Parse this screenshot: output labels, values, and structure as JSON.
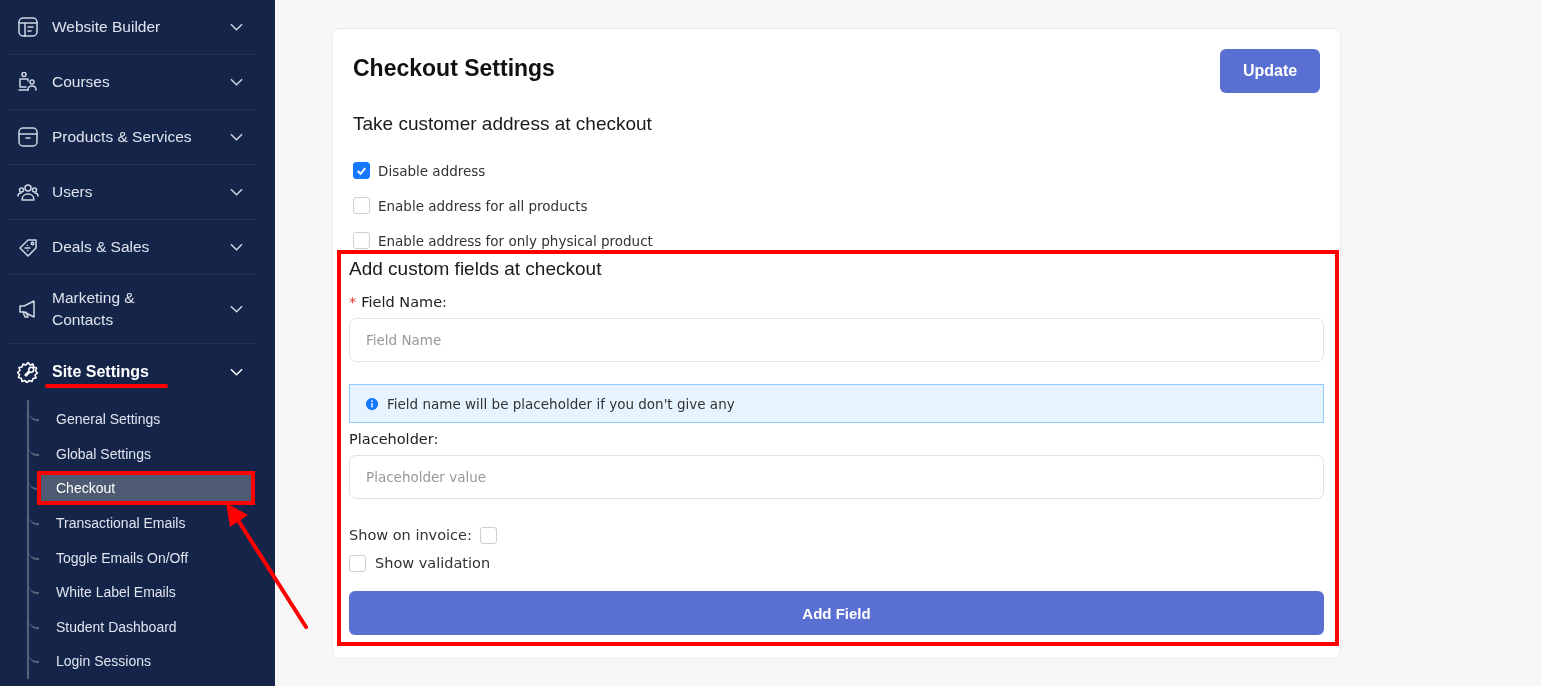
{
  "sidebar": {
    "items": [
      {
        "kind": "layout",
        "label": "Website Builder",
        "expanded": false,
        "selected": false
      },
      {
        "kind": "courses",
        "label": "Courses",
        "expanded": false,
        "selected": false
      },
      {
        "kind": "box",
        "label": "Products & Services",
        "expanded": false,
        "selected": false
      },
      {
        "kind": "users",
        "label": "Users",
        "expanded": false,
        "selected": false
      },
      {
        "kind": "tag",
        "label": "Deals & Sales",
        "expanded": false,
        "selected": false
      },
      {
        "kind": "megaphone",
        "label": "Marketing & Contacts",
        "expanded": false,
        "selected": false
      },
      {
        "kind": "gear",
        "label": "Site Settings",
        "expanded": true,
        "selected": true,
        "underlined": true,
        "children": [
          {
            "label": "General Settings",
            "selected": false,
            "highlighted": false
          },
          {
            "label": "Global Settings",
            "selected": false,
            "highlighted": false
          },
          {
            "label": "Checkout",
            "selected": true,
            "highlighted": true
          },
          {
            "label": "Transactional Emails",
            "selected": false,
            "highlighted": false
          },
          {
            "label": "Toggle Emails On/Off",
            "selected": false,
            "highlighted": false
          },
          {
            "label": "White Label Emails",
            "selected": false,
            "highlighted": false
          },
          {
            "label": "Student Dashboard",
            "selected": false,
            "highlighted": false
          },
          {
            "label": "Login Sessions",
            "selected": false,
            "highlighted": false
          }
        ]
      }
    ]
  },
  "page": {
    "title": "Checkout Settings",
    "update_button": "Update",
    "address": {
      "heading": "Take customer address at checkout",
      "options": [
        {
          "label": "Disable address",
          "checked": true
        },
        {
          "label": "Enable address for all products",
          "checked": false
        },
        {
          "label": "Enable address for only physical product",
          "checked": false
        }
      ]
    },
    "custom_fields": {
      "highlighted": true,
      "heading": "Add custom fields at checkout",
      "required_mark": "*",
      "field_name_label": "Field Name:",
      "field_name": {
        "placeholder": "Field Name"
      },
      "info": "Field name will be placeholder if you don't give any",
      "placeholder_label": "Placeholder:",
      "placeholder_field": {
        "placeholder": "Placeholder value"
      },
      "show_on_invoice": {
        "label": "Show on invoice:",
        "checked": false
      },
      "show_validation": {
        "label": "Show validation",
        "checked": false
      },
      "add_button": "Add Field"
    }
  }
}
